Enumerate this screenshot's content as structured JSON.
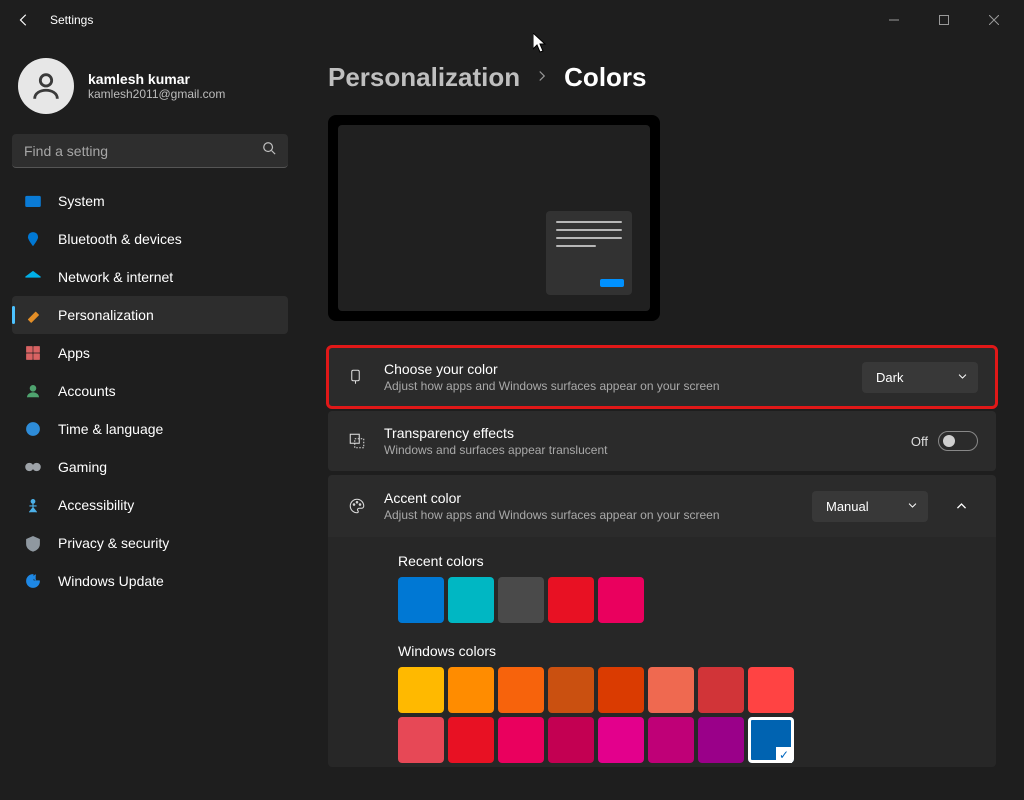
{
  "titlebar": {
    "label": "Settings"
  },
  "user": {
    "name": "kamlesh kumar",
    "email": "kamlesh2011@gmail.com"
  },
  "search": {
    "placeholder": "Find a setting"
  },
  "sidebar": {
    "items": [
      {
        "label": "System",
        "color": "#0a7bd6"
      },
      {
        "label": "Bluetooth & devices",
        "color": "#0078d4"
      },
      {
        "label": "Network & internet",
        "color": "#00b0e8"
      },
      {
        "label": "Personalization",
        "color": "#e38e27"
      },
      {
        "label": "Apps",
        "color": "#d86363"
      },
      {
        "label": "Accounts",
        "color": "#4fa36f"
      },
      {
        "label": "Time & language",
        "color": "#2e8cd8"
      },
      {
        "label": "Gaming",
        "color": "#9ea3a8"
      },
      {
        "label": "Accessibility",
        "color": "#4cb0e8"
      },
      {
        "label": "Privacy & security",
        "color": "#8f98a0"
      },
      {
        "label": "Windows Update",
        "color": "#1e88e5"
      }
    ],
    "active_index": 3
  },
  "breadcrumb": {
    "parent": "Personalization",
    "current": "Colors"
  },
  "choose_color": {
    "title": "Choose your color",
    "desc": "Adjust how apps and Windows surfaces appear on your screen",
    "value": "Dark"
  },
  "transparency": {
    "title": "Transparency effects",
    "desc": "Windows and surfaces appear translucent",
    "state_label": "Off"
  },
  "accent": {
    "title": "Accent color",
    "desc": "Adjust how apps and Windows surfaces appear on your screen",
    "value": "Manual",
    "recent_label": "Recent colors",
    "windows_label": "Windows colors",
    "recent_colors": [
      "#0078d4",
      "#00b7c3",
      "#4a4a4a",
      "#e81123",
      "#ea005e"
    ],
    "windows_colors_row1": [
      "#ffb900",
      "#ff8c00",
      "#f7630c",
      "#ca5010",
      "#da3b01",
      "#ef6950",
      "#d13438",
      "#ff4343"
    ],
    "windows_colors_row2": [
      "#e74856",
      "#e81123",
      "#ea005e",
      "#c30052",
      "#e3008c",
      "#bf0077",
      "#9a0089",
      "#0063b1"
    ],
    "selected_color": "#0063b1"
  }
}
